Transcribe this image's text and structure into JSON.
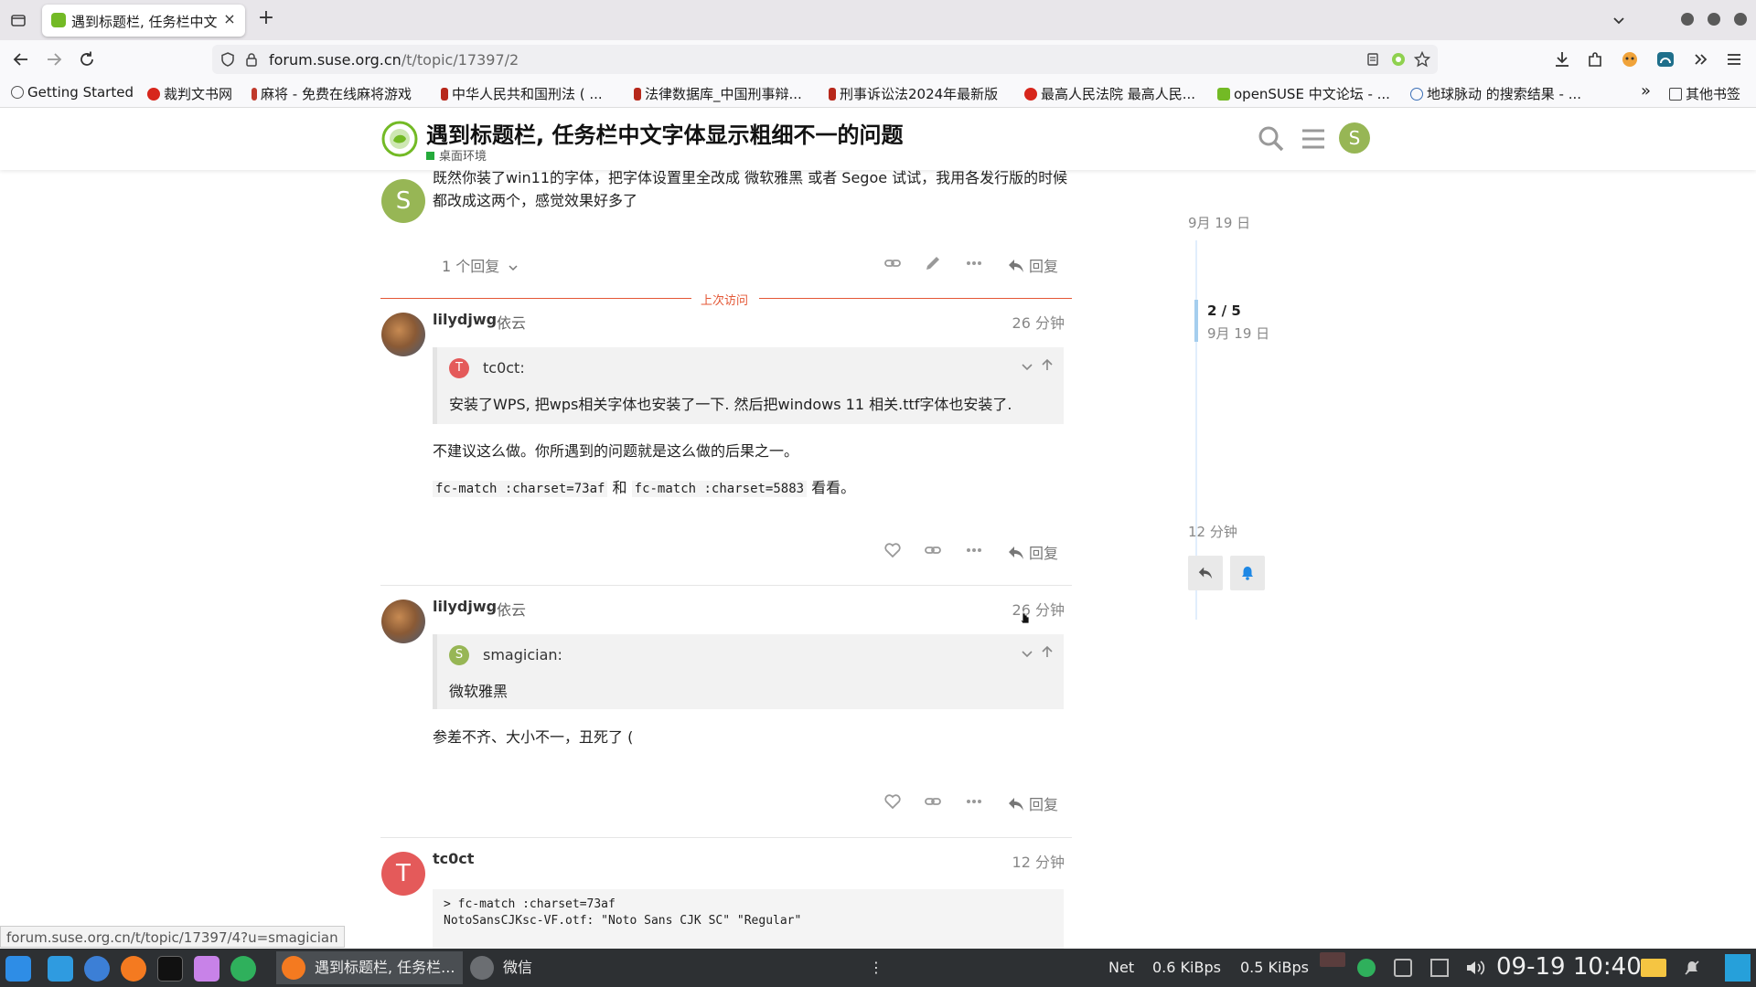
{
  "browser": {
    "tab_title": "遇到标题栏, 任务栏中文",
    "tab_close": "×",
    "new_tab": "+",
    "url_host": "forum.suse.org.cn",
    "url_path": "/t/topic/17397/2",
    "bookmarks": [
      {
        "label": "Getting Started",
        "color": "#555555"
      },
      {
        "label": "裁判文书网",
        "color": "#d7261c"
      },
      {
        "label": "麻将 - 免费在线麻将游戏",
        "color": "#c0392b"
      },
      {
        "label": "中华人民共和国刑法 ( ...",
        "color": "#b7281b"
      },
      {
        "label": "法律数据库_中国刑事辩...",
        "color": "#b7281b"
      },
      {
        "label": "刑事诉讼法2024年最新版",
        "color": "#b7281b"
      },
      {
        "label": "最高人民法院 最高人民...",
        "color": "#d7261c"
      },
      {
        "label": "openSUSE 中文论坛 - ...",
        "color": "#73ba25"
      },
      {
        "label": "地球脉动 的搜索结果 - ...",
        "color": "#3b6fb6"
      }
    ],
    "bookmarks_more": "»",
    "other_bookmarks": "其他书签"
  },
  "header": {
    "topic_title": "遇到标题栏, 任务栏中文字体显示粗细不一的问题",
    "category": "桌面环境",
    "avatar_letter": "S"
  },
  "posts": [
    {
      "avatar_letter": "S",
      "text_line1": "既然你装了win11的字体，把字体设置里全改成 微软雅黑 或者 Segoe 试试，我用各发行版的时候",
      "text_line2": "都改成这两个，感觉效果好多了",
      "replies_toggle": "1 个回复",
      "reply_label": "回复"
    },
    {
      "username": "lilydjwg",
      "fullname": "依云",
      "date": "26 分钟",
      "quote_letter": "T",
      "quote_name": "tc0ct:",
      "quote_text": "安装了WPS, 把wps相关字体也安装了一下. 然后把windows 11 相关.ttf字体也安装了.",
      "body": "不建议这么做。你所遇到的问题就是这么做的后果之一。",
      "code1": "fc-match :charset=73af",
      "conj": "和",
      "code2": "fc-match :charset=5883",
      "tail": "看看。",
      "reply_label": "回复"
    },
    {
      "username": "lilydjwg",
      "fullname": "依云",
      "date": "26 分钟",
      "quote_letter": "S",
      "quote_name": "smagician:",
      "quote_text": "微软雅黑",
      "body": "参差不齐、大小不一，丑死了 (",
      "reply_label": "回复"
    },
    {
      "avatar_letter": "T",
      "username": "tc0ct",
      "date": "12 分钟",
      "pre_line1": "> fc-match :charset=73af",
      "pre_line2": "NotoSansCJKsc-VF.otf: \"Noto Sans CJK SC\" \"Regular\""
    }
  ],
  "last_visit": "上次访问",
  "timeline": {
    "top_date": "9月 19 日",
    "position": "2 / 5",
    "position_date": "9月 19 日",
    "bottom_date": "12 分钟"
  },
  "status_link": "forum.suse.org.cn/t/topic/17397/4?u=smagician",
  "taskbar": {
    "firefox_window": "遇到标题栏, 任务栏...",
    "wechat_window": "微信",
    "separator": "⋮",
    "net_label": "Net",
    "net_down": "0.6 KiBps",
    "net_up": "0.5 KiBps",
    "clock": "09-19 10:40"
  },
  "colors": {
    "accent_red": "#e45735",
    "suse_green": "#73ba25",
    "avatar_s": "#97b655",
    "avatar_t": "#e45a5a"
  }
}
